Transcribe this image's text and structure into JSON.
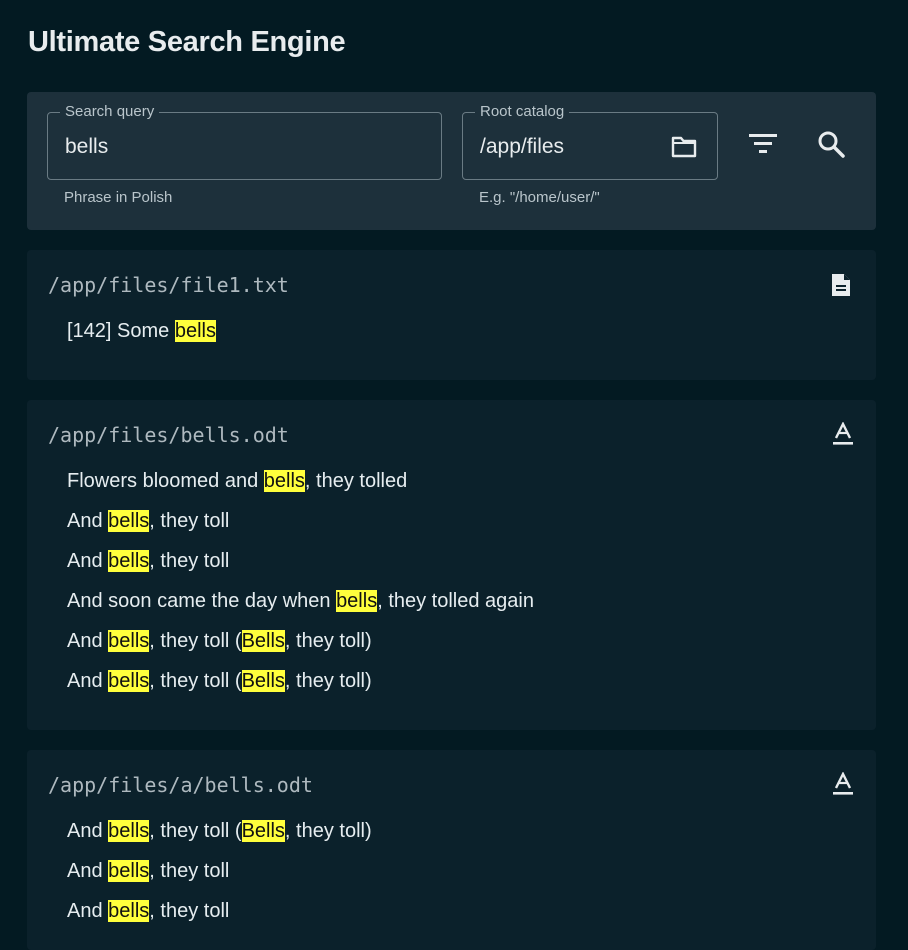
{
  "app": {
    "title": "Ultimate Search Engine"
  },
  "search": {
    "query_label": "Search query",
    "query_value": "bells",
    "query_helper": "Phrase in Polish",
    "root_label": "Root catalog",
    "root_value": "/app/files",
    "root_helper": "E.g. \"/home/user/\""
  },
  "icons": {
    "folder": "folder-icon",
    "filter": "filter-icon",
    "search": "search-icon",
    "text_file": "document-icon",
    "odt_file": "text-format-icon"
  },
  "colors": {
    "highlight": "#ffff3c",
    "background": "#031a22",
    "panel": "#1d303b",
    "card": "#0b212b"
  },
  "results": [
    {
      "path": "/app/files/file1.txt",
      "icon": "document-icon",
      "lines": [
        [
          {
            "t": "[142] Some "
          },
          {
            "t": "bells",
            "h": true
          }
        ]
      ]
    },
    {
      "path": "/app/files/bells.odt",
      "icon": "text-format-icon",
      "lines": [
        [
          {
            "t": "Flowers bloomed and "
          },
          {
            "t": "bells",
            "h": true
          },
          {
            "t": ", they tolled"
          }
        ],
        [
          {
            "t": "And "
          },
          {
            "t": "bells",
            "h": true
          },
          {
            "t": ", they toll"
          }
        ],
        [
          {
            "t": "And "
          },
          {
            "t": "bells",
            "h": true
          },
          {
            "t": ", they toll"
          }
        ],
        [
          {
            "t": "And soon came the day when "
          },
          {
            "t": "bells",
            "h": true
          },
          {
            "t": ", they tolled again"
          }
        ],
        [
          {
            "t": "And "
          },
          {
            "t": "bells",
            "h": true
          },
          {
            "t": ", they toll ("
          },
          {
            "t": "Bells",
            "h": true
          },
          {
            "t": ", they toll)"
          }
        ],
        [
          {
            "t": "And "
          },
          {
            "t": "bells",
            "h": true
          },
          {
            "t": ", they toll ("
          },
          {
            "t": "Bells",
            "h": true
          },
          {
            "t": ", they toll)"
          }
        ]
      ]
    },
    {
      "path": "/app/files/a/bells.odt",
      "icon": "text-format-icon",
      "lines": [
        [
          {
            "t": "And "
          },
          {
            "t": "bells",
            "h": true
          },
          {
            "t": ", they toll ("
          },
          {
            "t": "Bells",
            "h": true
          },
          {
            "t": ", they toll)"
          }
        ],
        [
          {
            "t": "And "
          },
          {
            "t": "bells",
            "h": true
          },
          {
            "t": ", they toll"
          }
        ],
        [
          {
            "t": "And "
          },
          {
            "t": "bells",
            "h": true
          },
          {
            "t": ", they toll"
          }
        ]
      ]
    }
  ]
}
